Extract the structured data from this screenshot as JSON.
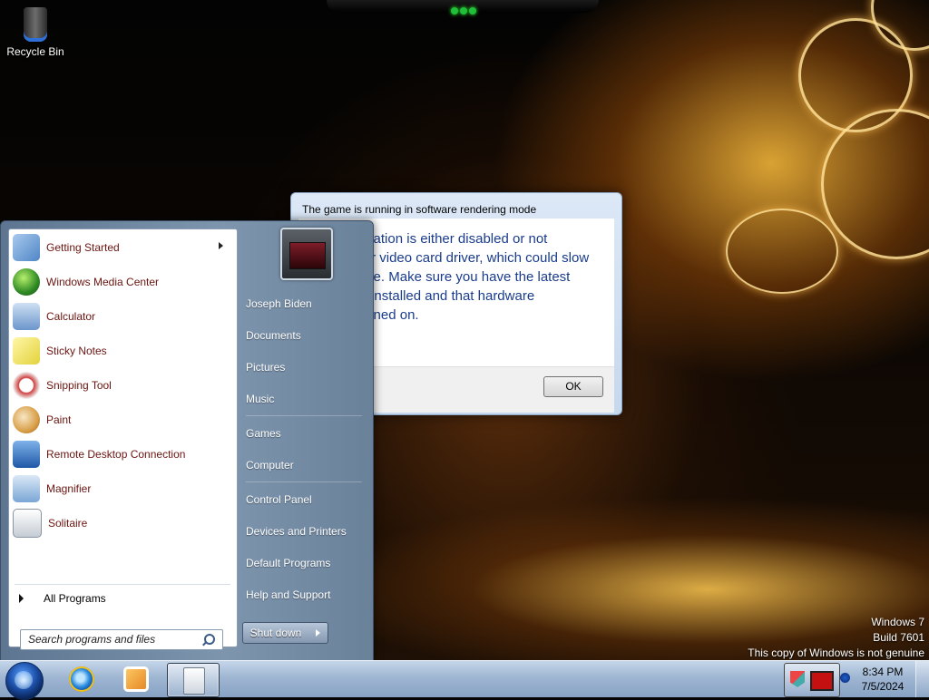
{
  "desktop": {
    "icons": [
      {
        "label": "Recycle Bin",
        "icon": "recycle-bin-icon"
      }
    ],
    "watermark": {
      "line1": "Windows 7",
      "line2": "Build 7601",
      "line3": "This copy of Windows is not genuine"
    }
  },
  "dialog": {
    "title": "The game is running in software rendering mode",
    "message": "Hardware acceleration is either disabled or not supported by your video card driver, which could slow game performance. Make sure you have the latest video card driver installed and that hardware acceleration is turned on.",
    "ok_label": "OK"
  },
  "start_menu": {
    "programs": [
      {
        "label": "Getting Started",
        "icon": "getting-started-icon",
        "has_submenu": true,
        "color": "#6aa0d8"
      },
      {
        "label": "Windows Media Center",
        "icon": "media-center-icon",
        "has_submenu": false,
        "color": "#3c9a2e"
      },
      {
        "label": "Calculator",
        "icon": "calculator-icon",
        "has_submenu": false,
        "color": "#5d8bc7"
      },
      {
        "label": "Sticky Notes",
        "icon": "sticky-notes-icon",
        "has_submenu": false,
        "color": "#e6d84a"
      },
      {
        "label": "Snipping Tool",
        "icon": "snipping-tool-icon",
        "has_submenu": false,
        "color": "#c83a3a"
      },
      {
        "label": "Paint",
        "icon": "paint-icon",
        "has_submenu": false,
        "color": "#d98a2b"
      },
      {
        "label": "Remote Desktop Connection",
        "icon": "remote-desktop-icon",
        "has_submenu": false,
        "color": "#2f6fbf"
      },
      {
        "label": "Magnifier",
        "icon": "magnifier-icon",
        "has_submenu": false,
        "color": "#7aa6d6"
      },
      {
        "label": "Solitaire",
        "icon": "solitaire-icon",
        "has_submenu": false,
        "color": "#d0d6dc"
      }
    ],
    "all_programs_label": "All Programs",
    "search_placeholder": "Search programs and files",
    "user_name": "Joseph Biden",
    "links": [
      "Documents",
      "Pictures",
      "Music",
      "Games",
      "Computer",
      "Control Panel",
      "Devices and Printers",
      "Default Programs",
      "Help and Support"
    ],
    "shutdown_label": "Shut down"
  },
  "taskbar": {
    "pinned": [
      {
        "icon": "internet-explorer-icon",
        "active": false
      },
      {
        "icon": "media-player-icon",
        "active": false
      },
      {
        "icon": "solitaire-icon",
        "active": true
      }
    ],
    "tray": {
      "icons": [
        "action-center-flag-icon",
        "notification-icon",
        "network-icon"
      ],
      "time": "8:34 PM",
      "date": "7/5/2024"
    }
  },
  "colors": {
    "program_text": "#6b1410",
    "dialog_text": "#1a3c8c",
    "start_menu_bg": "#7e95ae",
    "taskbar_bg": "#9fb6d2"
  }
}
